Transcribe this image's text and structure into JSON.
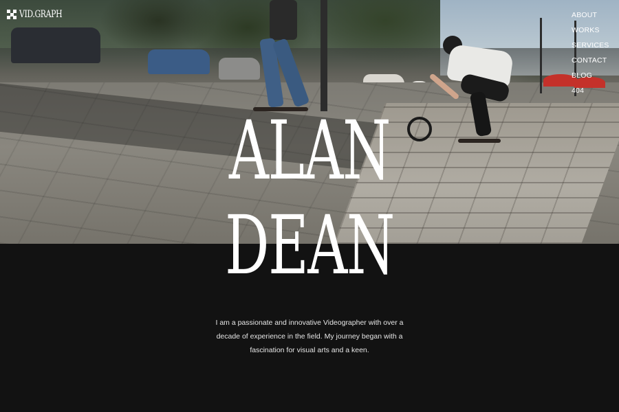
{
  "header": {
    "logo_text": "VID.GRAPH"
  },
  "nav": {
    "items": [
      {
        "label": "ABOUT"
      },
      {
        "label": "WORKS"
      },
      {
        "label": "SERVICES"
      },
      {
        "label": "CONTACT"
      },
      {
        "label": "BLOG"
      },
      {
        "label": "404"
      }
    ]
  },
  "hero": {
    "title_line_1": "ALAN",
    "title_line_2": "DEAN"
  },
  "intro": {
    "text": "I am a passionate and innovative Videographer with over a decade of experience in the field. My journey began with a fascination for visual arts and a keen."
  },
  "colors": {
    "background": "#121212",
    "text": "#ffffff"
  },
  "icons": {
    "logo_mark": "checker-logo-icon"
  }
}
